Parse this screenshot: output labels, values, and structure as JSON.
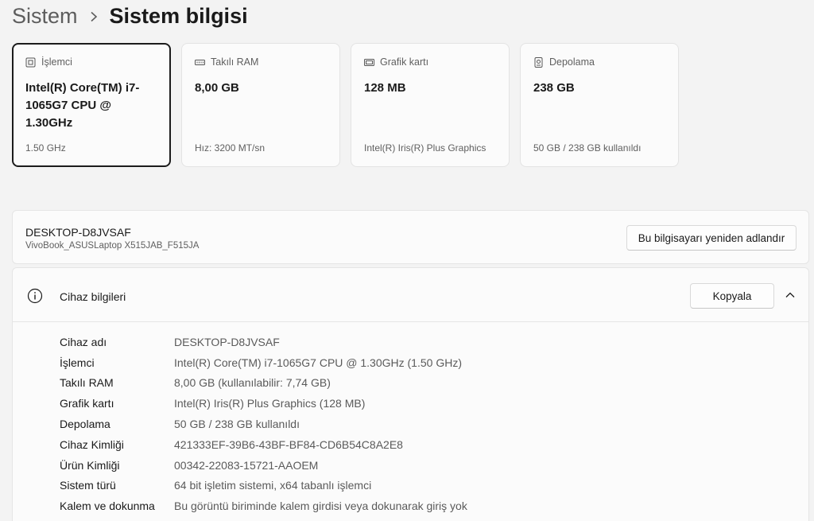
{
  "breadcrumb": {
    "parent": "Sistem",
    "current": "Sistem bilgisi"
  },
  "cards": [
    {
      "icon": "processor-icon",
      "label": "İşlemci",
      "value": "Intel(R) Core(TM) i7-1065G7 CPU @ 1.30GHz",
      "sub": "1.50 GHz",
      "selected": true
    },
    {
      "icon": "ram-icon",
      "label": "Takılı RAM",
      "value": "8,00 GB",
      "sub": "Hız: 3200 MT/sn",
      "selected": false
    },
    {
      "icon": "graphics-card-icon",
      "label": "Grafik kartı",
      "value": "128 MB",
      "sub": "Intel(R) Iris(R) Plus Graphics",
      "selected": false
    },
    {
      "icon": "storage-icon",
      "label": "Depolama",
      "value": "238 GB",
      "sub": "50 GB / 238 GB kullanıldı",
      "selected": false
    }
  ],
  "device": {
    "name": "DESKTOP-D8JVSAF",
    "model": "VivoBook_ASUSLaptop X515JAB_F515JA",
    "rename_label": "Bu bilgisayarı yeniden adlandır"
  },
  "info": {
    "title": "Cihaz bilgileri",
    "copy_label": "Kopyala",
    "rows": [
      {
        "key": "Cihaz adı",
        "value": "DESKTOP-D8JVSAF"
      },
      {
        "key": "İşlemci",
        "value": "Intel(R) Core(TM) i7-1065G7 CPU @ 1.30GHz (1.50 GHz)"
      },
      {
        "key": "Takılı RAM",
        "value": "8,00 GB (kullanılabilir: 7,74 GB)"
      },
      {
        "key": "Grafik kartı",
        "value": "Intel(R) Iris(R) Plus Graphics (128 MB)"
      },
      {
        "key": "Depolama",
        "value": "50 GB / 238 GB kullanıldı"
      },
      {
        "key": "Cihaz Kimliği",
        "value": "421333EF-39B6-43BF-BF84-CD6B54C8A2E8"
      },
      {
        "key": "Ürün Kimliği",
        "value": "00342-22083-15721-AAOEM"
      },
      {
        "key": "Sistem türü",
        "value": "64 bit işletim sistemi, x64 tabanlı işlemci"
      },
      {
        "key": "Kalem ve dokunma",
        "value": "Bu görüntü biriminde kalem girdisi veya dokunarak giriş yok"
      }
    ]
  }
}
